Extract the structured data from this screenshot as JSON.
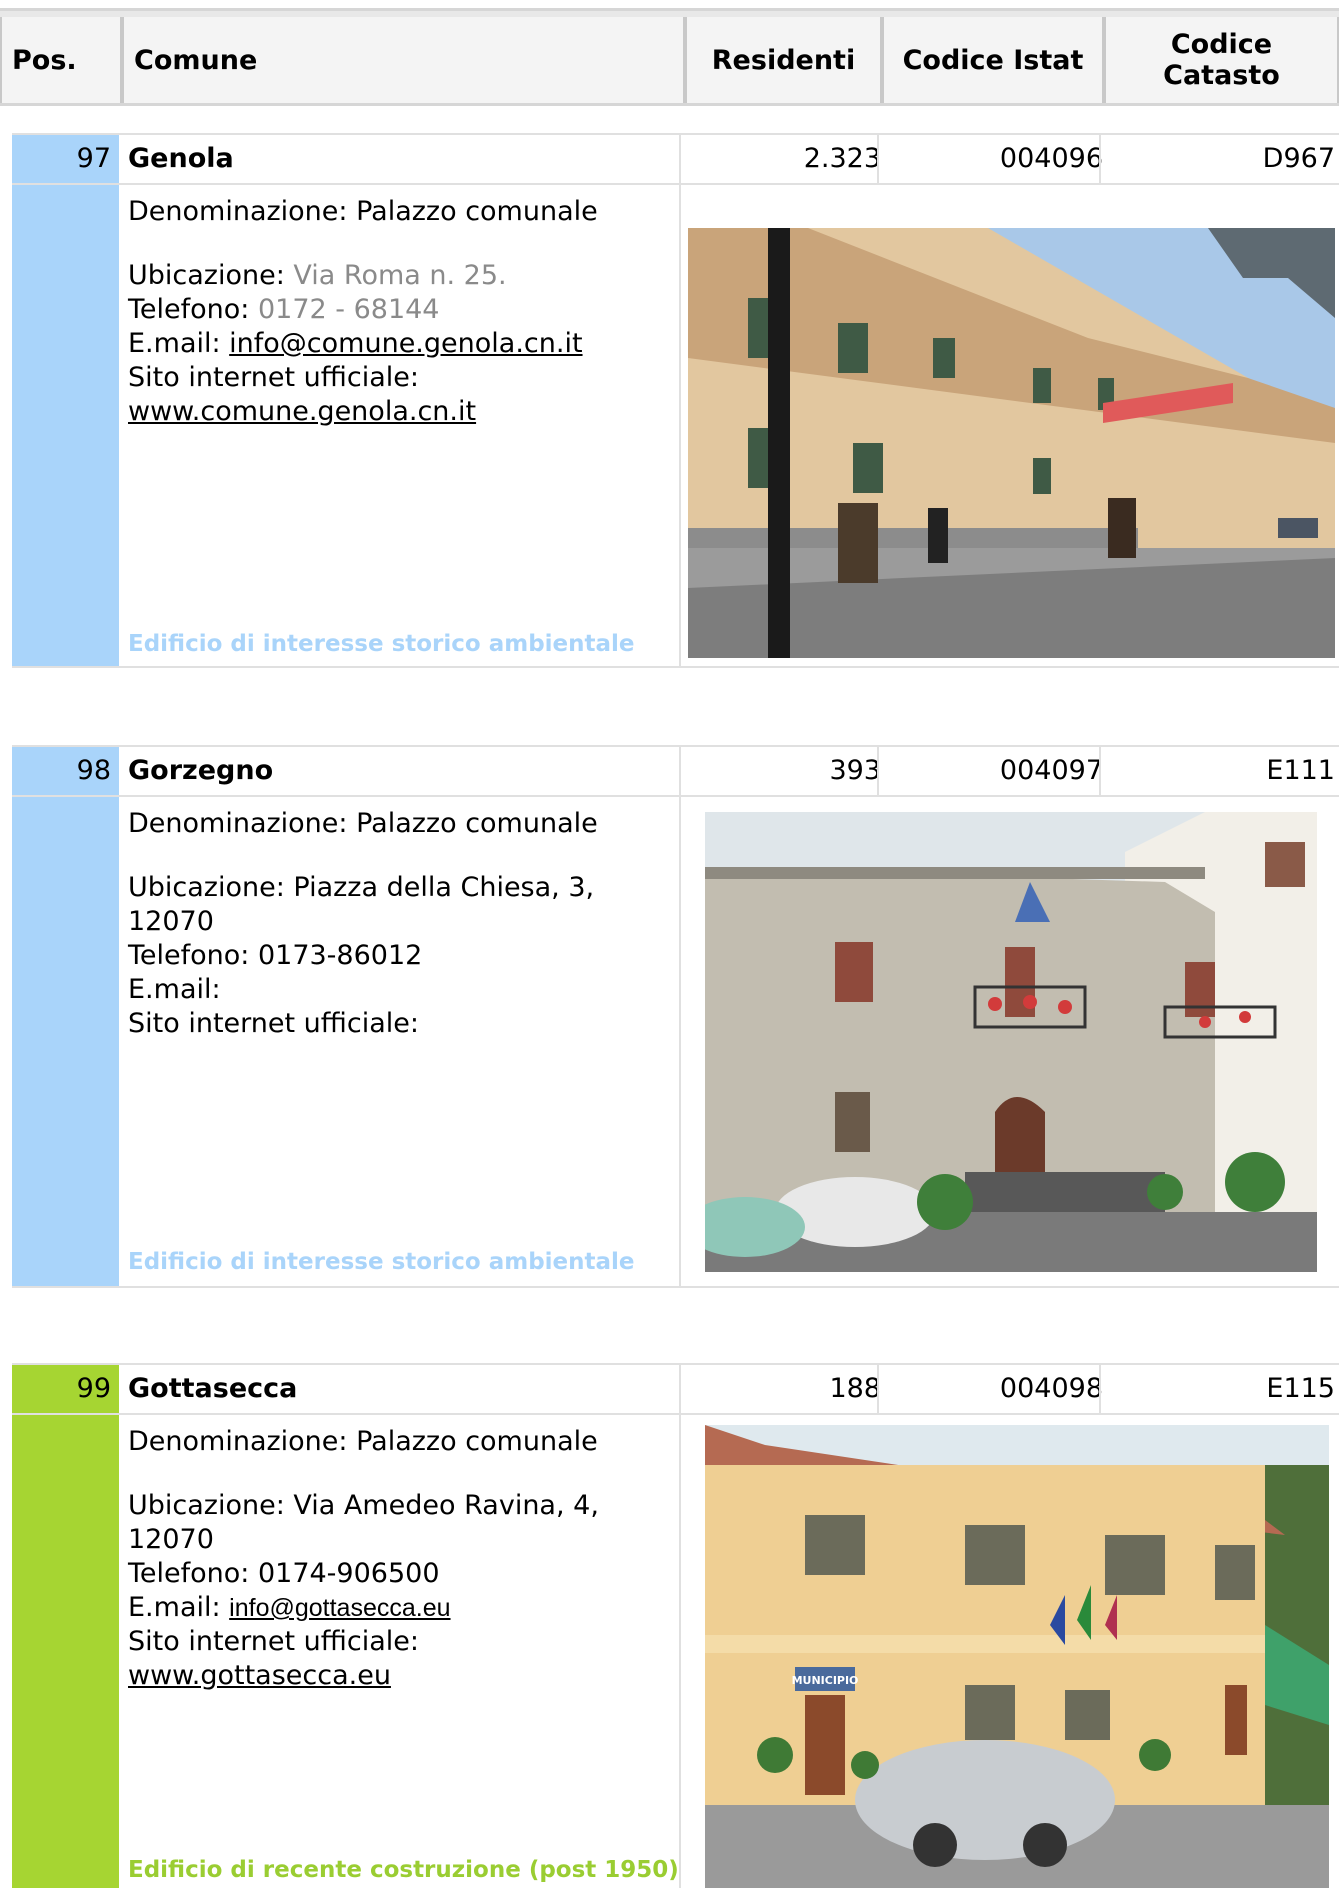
{
  "header": {
    "pos": "Pos.",
    "comune": "Comune",
    "residenti": "Residenti",
    "codice_istat": "Codice Istat",
    "codice_catasto": "Codice Catasto"
  },
  "entries": [
    {
      "pos": "97",
      "name": "Genola",
      "residenti": "2.323",
      "istat": "004096",
      "catasto": "D967",
      "denominazione": "Denominazione: Palazzo comunale",
      "ubicazione_label": "Ubicazione: ",
      "ubicazione": "Via Roma n. 25.",
      "telefono_label": "Telefono: ",
      "telefono": "0172 - 68144",
      "email_label": "E.mail: ",
      "email": "info@comune.genola.cn.it",
      "sito_label": "Sito internet ufficiale:",
      "sito": "www.comune.genola.cn.it",
      "tag": "Edificio di interesse storico ambientale",
      "color": "#a9d4fa",
      "tag_color": "#a9d4fa"
    },
    {
      "pos": "98",
      "name": "Gorzegno",
      "residenti": "393",
      "istat": "004097",
      "catasto": "E111",
      "denominazione": "Denominazione: Palazzo comunale",
      "ubicazione_label": "Ubicazione: ",
      "ubicazione": "Piazza della Chiesa, 3, 12070",
      "telefono_label": "Telefono: ",
      "telefono": "0173-86012",
      "email_label": "E.mail:",
      "email": "",
      "sito_label": "Sito internet ufficiale:",
      "sito": "",
      "tag": "Edificio di interesse storico ambientale",
      "color": "#a9d4fa",
      "tag_color": "#a9d4fa"
    },
    {
      "pos": "99",
      "name": "Gottasecca",
      "residenti": "188",
      "istat": "004098",
      "catasto": "E115",
      "denominazione": "Denominazione: Palazzo comunale",
      "ubicazione_label": "Ubicazione: ",
      "ubicazione": "Via Amedeo Ravina, 4, 12070",
      "telefono_label": "Telefono: ",
      "telefono": "0174-906500",
      "email_label": "E.mail: ",
      "email": "info@gottasecca.eu",
      "sito_label": "Sito internet ufficiale:",
      "sito": "www.gottasecca.eu",
      "tag": "Edificio di recente costruzione (post 1950)",
      "color": "#a6d532",
      "tag_color": "#9acd32"
    }
  ],
  "photo_1_sign": "MUNICIPIO"
}
